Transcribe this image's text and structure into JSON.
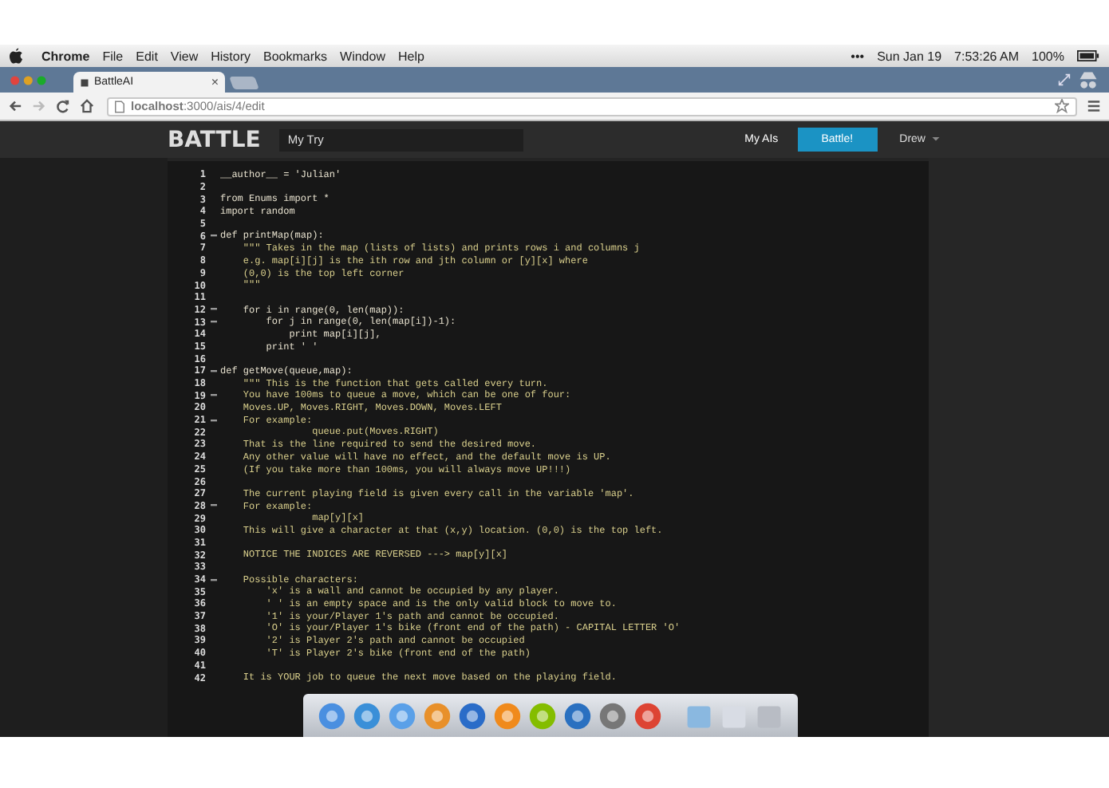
{
  "menu_bar": {
    "app": "Chrome",
    "items": [
      "File",
      "Edit",
      "View",
      "History",
      "Bookmarks",
      "Window",
      "Help"
    ],
    "status": [
      "•••",
      "Sun Jan 19",
      "7:53:26 AM",
      "100%"
    ]
  },
  "browser": {
    "tab": {
      "title": "BattleAI",
      "close": "×"
    },
    "url": "**localhost**:3000/ais/4/edit"
  },
  "nav": {
    "logo": "BATTLE",
    "name_field": {
      "value": "My Try"
    },
    "links": [
      "My AIs"
    ],
    "battle_button": "Battle!",
    "user": "Drew"
  },
  "editor": {
    "lines": [
      {
        "n": "1",
        "text": "__author__ = 'Julian'",
        "kind": "code",
        "fold": false
      },
      {
        "n": "2",
        "fold": false
      },
      {
        "n": "3",
        "text": "from Enums import *",
        "kind": "code",
        "fold": false
      },
      {
        "n": "4",
        "text": "import random",
        "kind": "code",
        "fold": false
      },
      {
        "n": "5",
        "fold": false
      },
      {
        "n": "6",
        "text": "def printMap(map):",
        "kind": "code",
        "fold": true
      },
      {
        "n": "7",
        "text": "    \"\"\" Takes in the map (lists of lists) and prints rows i and columns j",
        "kind": "string",
        "fold": false
      },
      {
        "n": "8",
        "text": "    e.g. map[i][j] is the ith row and jth column or [y][x] where",
        "kind": "string",
        "fold": false
      },
      {
        "n": "9",
        "text": "    (0,0) is the top left corner",
        "kind": "string",
        "fold": false
      },
      {
        "n": "10",
        "text": "    \"\"\"",
        "kind": "string",
        "fold": false
      },
      {
        "n": "11",
        "fold": false
      },
      {
        "n": "12",
        "text": "    for i in range(0, len(map)):",
        "kind": "code",
        "fold": true
      },
      {
        "n": "13",
        "text": "        for j in range(0, len(map[i])-1):",
        "kind": "code",
        "fold": true
      },
      {
        "n": "14",
        "text": "            print map[i][j],",
        "kind": "code",
        "fold": false
      },
      {
        "n": "15",
        "text": "        print ' '",
        "kind": "code",
        "fold": false
      },
      {
        "n": "16",
        "fold": false
      },
      {
        "n": "17",
        "text": "def getMove(queue,map):",
        "kind": "code",
        "fold": true
      },
      {
        "n": "18",
        "text": "    \"\"\" This is the function that gets called every turn.",
        "kind": "string",
        "fold": false
      },
      {
        "n": "19",
        "text": "    You have 100ms to queue a move, which can be one of four:",
        "kind": "string",
        "fold": true
      },
      {
        "n": "20",
        "text": "    Moves.UP, Moves.RIGHT, Moves.DOWN, Moves.LEFT",
        "kind": "string",
        "fold": false
      },
      {
        "n": "21",
        "text": "    For example:",
        "kind": "string",
        "fold": true
      },
      {
        "n": "22",
        "text": "                queue.put(Moves.RIGHT)",
        "kind": "string",
        "fold": false
      },
      {
        "n": "23",
        "text": "    That is the line required to send the desired move.",
        "kind": "string",
        "fold": false
      },
      {
        "n": "24",
        "text": "    Any other value will have no effect, and the default move is UP.",
        "kind": "string",
        "fold": false
      },
      {
        "n": "25",
        "text": "    (If you take more than 100ms, you will always move UP!!!)",
        "kind": "string",
        "fold": false
      },
      {
        "n": "26",
        "fold": false
      },
      {
        "n": "27",
        "text": "    The current playing field is given every call in the variable 'map'.",
        "kind": "string",
        "fold": false
      },
      {
        "n": "28",
        "text": "    For example:",
        "kind": "string",
        "fold": true
      },
      {
        "n": "29",
        "text": "                map[y][x]",
        "kind": "string",
        "fold": false
      },
      {
        "n": "30",
        "text": "    This will give a character at that (x,y) location. (0,0) is the top left.",
        "kind": "string",
        "fold": false
      },
      {
        "n": "31",
        "fold": false
      },
      {
        "n": "32",
        "text": "    NOTICE THE INDICES ARE REVERSED ---> map[y][x]",
        "kind": "string",
        "fold": false
      },
      {
        "n": "33",
        "fold": false
      },
      {
        "n": "34",
        "text": "    Possible characters:",
        "kind": "string",
        "fold": true
      },
      {
        "n": "35",
        "text": "        'x' is a wall and cannot be occupied by any player.",
        "kind": "string",
        "fold": false
      },
      {
        "n": "36",
        "text": "        ' ' is an empty space and is the only valid block to move to.",
        "kind": "string",
        "fold": false
      },
      {
        "n": "37",
        "text": "        '1' is your/Player 1's path and cannot be occupied.",
        "kind": "string",
        "fold": false
      },
      {
        "n": "38",
        "text": "        'O' is your/Player 1's bike (front end of the path) - CAPITAL LETTER 'O'",
        "kind": "string",
        "fold": false
      },
      {
        "n": "39",
        "text": "        '2' is Player 2's path and cannot be occupied",
        "kind": "string",
        "fold": false
      },
      {
        "n": "40",
        "text": "        'T' is Player 2's bike (front end of the path)",
        "kind": "string",
        "fold": false
      },
      {
        "n": "41",
        "fold": false
      },
      {
        "n": "42",
        "text": "    It is YOUR job to queue the next move based on the playing field.",
        "kind": "string",
        "fold": false
      }
    ]
  }
}
